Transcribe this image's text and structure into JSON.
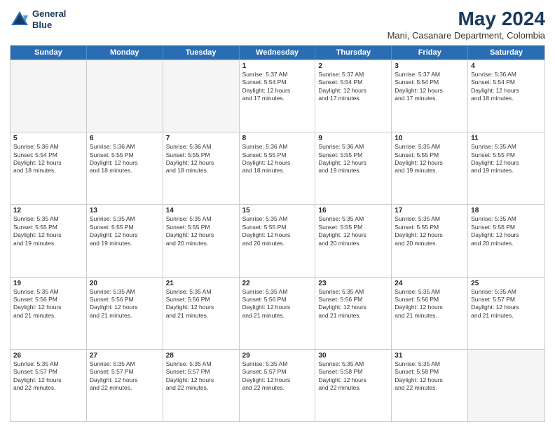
{
  "header": {
    "logo_line1": "General",
    "logo_line2": "Blue",
    "month": "May 2024",
    "location": "Mani, Casanare Department, Colombia"
  },
  "weekdays": [
    "Sunday",
    "Monday",
    "Tuesday",
    "Wednesday",
    "Thursday",
    "Friday",
    "Saturday"
  ],
  "rows": [
    [
      {
        "day": "",
        "info": ""
      },
      {
        "day": "",
        "info": ""
      },
      {
        "day": "",
        "info": ""
      },
      {
        "day": "1",
        "info": "Sunrise: 5:37 AM\nSunset: 5:54 PM\nDaylight: 12 hours\nand 17 minutes."
      },
      {
        "day": "2",
        "info": "Sunrise: 5:37 AM\nSunset: 5:54 PM\nDaylight: 12 hours\nand 17 minutes."
      },
      {
        "day": "3",
        "info": "Sunrise: 5:37 AM\nSunset: 5:54 PM\nDaylight: 12 hours\nand 17 minutes."
      },
      {
        "day": "4",
        "info": "Sunrise: 5:36 AM\nSunset: 5:54 PM\nDaylight: 12 hours\nand 18 minutes."
      }
    ],
    [
      {
        "day": "5",
        "info": "Sunrise: 5:36 AM\nSunset: 5:54 PM\nDaylight: 12 hours\nand 18 minutes."
      },
      {
        "day": "6",
        "info": "Sunrise: 5:36 AM\nSunset: 5:55 PM\nDaylight: 12 hours\nand 18 minutes."
      },
      {
        "day": "7",
        "info": "Sunrise: 5:36 AM\nSunset: 5:55 PM\nDaylight: 12 hours\nand 18 minutes."
      },
      {
        "day": "8",
        "info": "Sunrise: 5:36 AM\nSunset: 5:55 PM\nDaylight: 12 hours\nand 18 minutes."
      },
      {
        "day": "9",
        "info": "Sunrise: 5:36 AM\nSunset: 5:55 PM\nDaylight: 12 hours\nand 19 minutes."
      },
      {
        "day": "10",
        "info": "Sunrise: 5:35 AM\nSunset: 5:55 PM\nDaylight: 12 hours\nand 19 minutes."
      },
      {
        "day": "11",
        "info": "Sunrise: 5:35 AM\nSunset: 5:55 PM\nDaylight: 12 hours\nand 19 minutes."
      }
    ],
    [
      {
        "day": "12",
        "info": "Sunrise: 5:35 AM\nSunset: 5:55 PM\nDaylight: 12 hours\nand 19 minutes."
      },
      {
        "day": "13",
        "info": "Sunrise: 5:35 AM\nSunset: 5:55 PM\nDaylight: 12 hours\nand 19 minutes."
      },
      {
        "day": "14",
        "info": "Sunrise: 5:35 AM\nSunset: 5:55 PM\nDaylight: 12 hours\nand 20 minutes."
      },
      {
        "day": "15",
        "info": "Sunrise: 5:35 AM\nSunset: 5:55 PM\nDaylight: 12 hours\nand 20 minutes."
      },
      {
        "day": "16",
        "info": "Sunrise: 5:35 AM\nSunset: 5:55 PM\nDaylight: 12 hours\nand 20 minutes."
      },
      {
        "day": "17",
        "info": "Sunrise: 5:35 AM\nSunset: 5:55 PM\nDaylight: 12 hours\nand 20 minutes."
      },
      {
        "day": "18",
        "info": "Sunrise: 5:35 AM\nSunset: 5:56 PM\nDaylight: 12 hours\nand 20 minutes."
      }
    ],
    [
      {
        "day": "19",
        "info": "Sunrise: 5:35 AM\nSunset: 5:56 PM\nDaylight: 12 hours\nand 21 minutes."
      },
      {
        "day": "20",
        "info": "Sunrise: 5:35 AM\nSunset: 5:56 PM\nDaylight: 12 hours\nand 21 minutes."
      },
      {
        "day": "21",
        "info": "Sunrise: 5:35 AM\nSunset: 5:56 PM\nDaylight: 12 hours\nand 21 minutes."
      },
      {
        "day": "22",
        "info": "Sunrise: 5:35 AM\nSunset: 5:56 PM\nDaylight: 12 hours\nand 21 minutes."
      },
      {
        "day": "23",
        "info": "Sunrise: 5:35 AM\nSunset: 5:56 PM\nDaylight: 12 hours\nand 21 minutes."
      },
      {
        "day": "24",
        "info": "Sunrise: 5:35 AM\nSunset: 5:56 PM\nDaylight: 12 hours\nand 21 minutes."
      },
      {
        "day": "25",
        "info": "Sunrise: 5:35 AM\nSunset: 5:57 PM\nDaylight: 12 hours\nand 21 minutes."
      }
    ],
    [
      {
        "day": "26",
        "info": "Sunrise: 5:35 AM\nSunset: 5:57 PM\nDaylight: 12 hours\nand 22 minutes."
      },
      {
        "day": "27",
        "info": "Sunrise: 5:35 AM\nSunset: 5:57 PM\nDaylight: 12 hours\nand 22 minutes."
      },
      {
        "day": "28",
        "info": "Sunrise: 5:35 AM\nSunset: 5:57 PM\nDaylight: 12 hours\nand 22 minutes."
      },
      {
        "day": "29",
        "info": "Sunrise: 5:35 AM\nSunset: 5:57 PM\nDaylight: 12 hours\nand 22 minutes."
      },
      {
        "day": "30",
        "info": "Sunrise: 5:35 AM\nSunset: 5:58 PM\nDaylight: 12 hours\nand 22 minutes."
      },
      {
        "day": "31",
        "info": "Sunrise: 5:35 AM\nSunset: 5:58 PM\nDaylight: 12 hours\nand 22 minutes."
      },
      {
        "day": "",
        "info": ""
      }
    ]
  ]
}
